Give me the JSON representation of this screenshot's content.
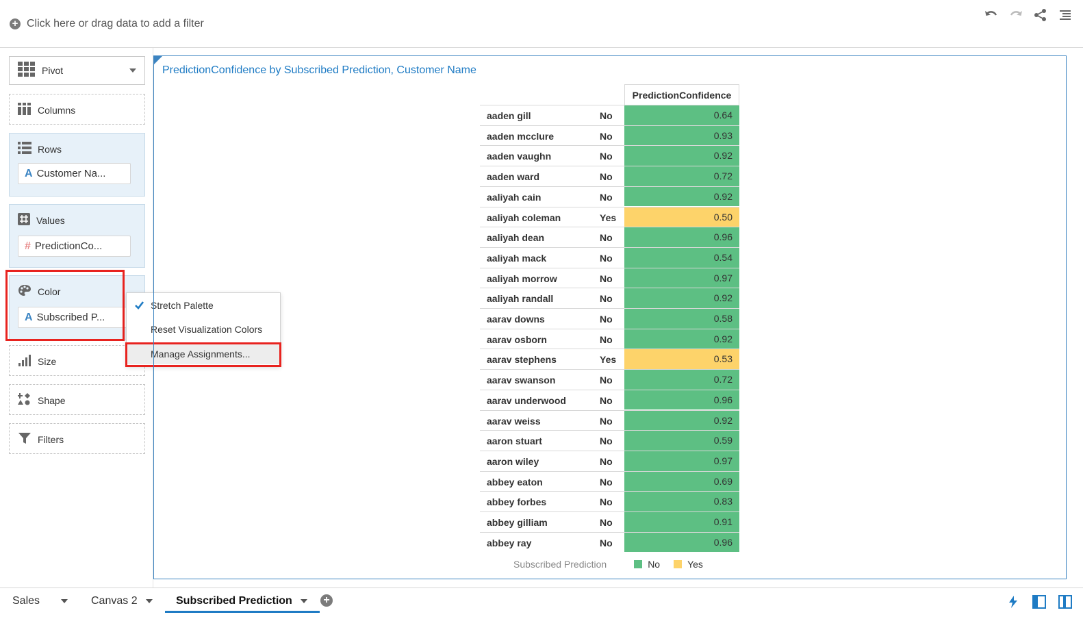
{
  "filter_bar": {
    "add_filter_text": "Click here or drag data to add a filter"
  },
  "grammar": {
    "viz_type": "Pivot",
    "columns_label": "Columns",
    "rows_label": "Rows",
    "rows_item": "Customer Na...",
    "values_label": "Values",
    "values_item": "PredictionCo...",
    "color_label": "Color",
    "color_item": "Subscribed P...",
    "size_label": "Size",
    "shape_label": "Shape",
    "filters_label": "Filters"
  },
  "context_menu": {
    "stretch_palette": "Stretch Palette",
    "reset_colors": "Reset Visualization Colors",
    "manage_assignments": "Manage Assignments..."
  },
  "viz": {
    "title": "PredictionConfidence by Subscribed Prediction, Customer Name",
    "value_header": "PredictionConfidence",
    "rows": [
      {
        "name": "aaden gill",
        "pred": "No",
        "val": "0.64"
      },
      {
        "name": "aaden mcclure",
        "pred": "No",
        "val": "0.93"
      },
      {
        "name": "aaden vaughn",
        "pred": "No",
        "val": "0.92"
      },
      {
        "name": "aaden ward",
        "pred": "No",
        "val": "0.72"
      },
      {
        "name": "aaliyah cain",
        "pred": "No",
        "val": "0.92"
      },
      {
        "name": "aaliyah coleman",
        "pred": "Yes",
        "val": "0.50"
      },
      {
        "name": "aaliyah dean",
        "pred": "No",
        "val": "0.96"
      },
      {
        "name": "aaliyah mack",
        "pred": "No",
        "val": "0.54"
      },
      {
        "name": "aaliyah morrow",
        "pred": "No",
        "val": "0.97"
      },
      {
        "name": "aaliyah randall",
        "pred": "No",
        "val": "0.92"
      },
      {
        "name": "aarav downs",
        "pred": "No",
        "val": "0.58"
      },
      {
        "name": "aarav osborn",
        "pred": "No",
        "val": "0.92"
      },
      {
        "name": "aarav stephens",
        "pred": "Yes",
        "val": "0.53"
      },
      {
        "name": "aarav swanson",
        "pred": "No",
        "val": "0.72"
      },
      {
        "name": "aarav underwood",
        "pred": "No",
        "val": "0.96"
      },
      {
        "name": "aarav weiss",
        "pred": "No",
        "val": "0.92"
      },
      {
        "name": "aaron stuart",
        "pred": "No",
        "val": "0.59"
      },
      {
        "name": "aaron wiley",
        "pred": "No",
        "val": "0.97"
      },
      {
        "name": "abbey eaton",
        "pred": "No",
        "val": "0.69"
      },
      {
        "name": "abbey forbes",
        "pred": "No",
        "val": "0.83"
      },
      {
        "name": "abbey gilliam",
        "pred": "No",
        "val": "0.91"
      },
      {
        "name": "abbey ray",
        "pred": "No",
        "val": "0.96"
      }
    ],
    "legend": {
      "title": "Subscribed Prediction",
      "items": [
        {
          "label": "No",
          "color": "#5dbf83"
        },
        {
          "label": "Yes",
          "color": "#fdd36a"
        }
      ]
    }
  },
  "tabs": [
    {
      "label": "Sales"
    },
    {
      "label": "Canvas 2"
    },
    {
      "label": "Subscribed Prediction"
    }
  ],
  "colors": {
    "accent": "#1e7bc4",
    "highlight": "#e8231f",
    "no": "#5dbf83",
    "yes": "#fdd36a"
  }
}
